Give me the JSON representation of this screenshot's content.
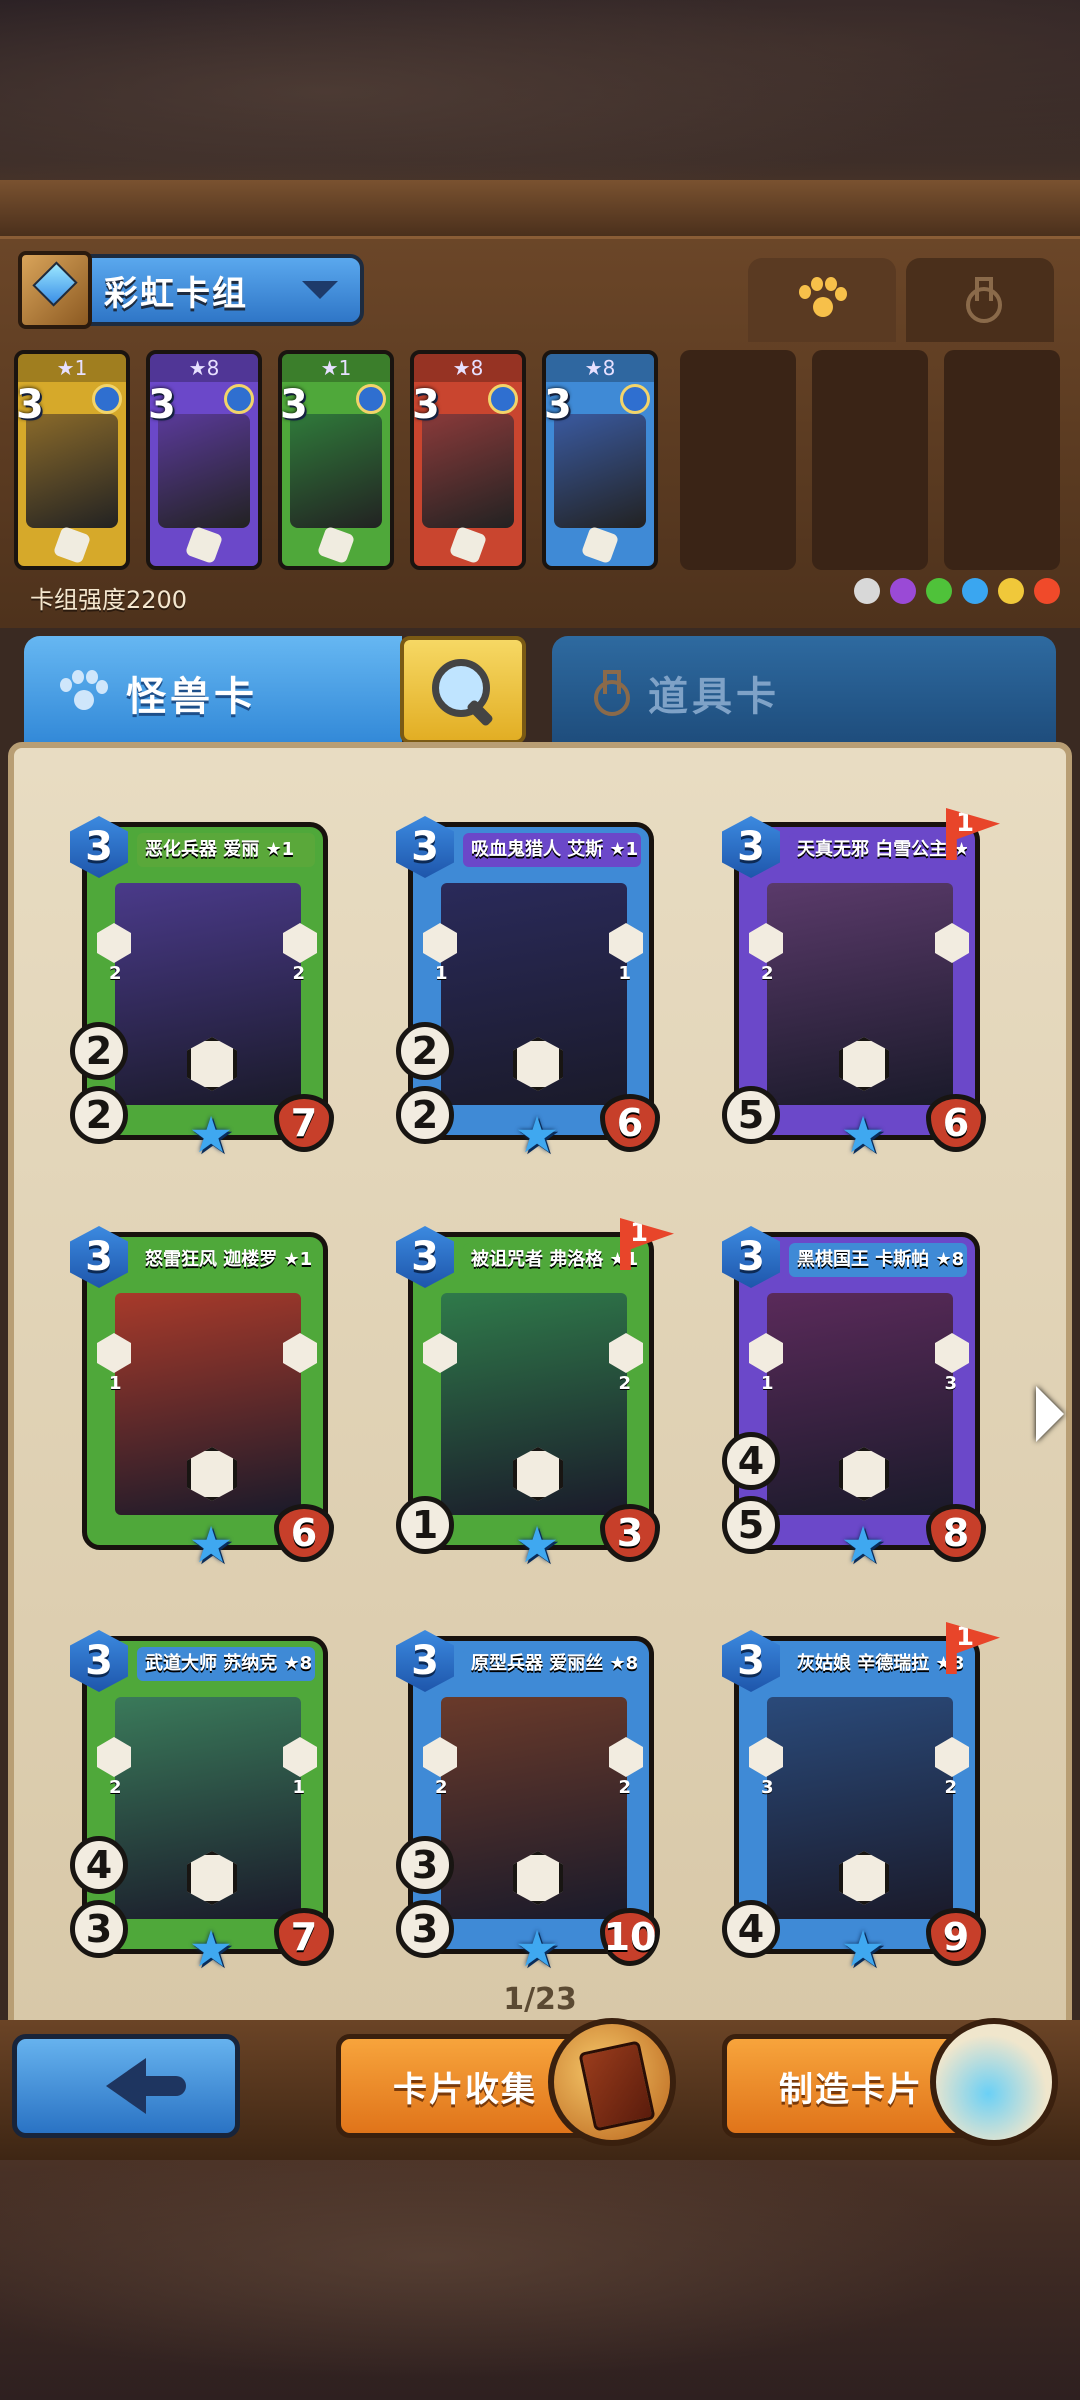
{
  "deck": {
    "name": "彩虹卡组",
    "strength_label": "卡组强度2200",
    "slots": [
      {
        "stars": "★1",
        "cost": "3",
        "color": "#d6a92a",
        "art": "#8a6a2a"
      },
      {
        "stars": "★8",
        "cost": "3",
        "color": "#6b48c9",
        "art": "#5a3a9a"
      },
      {
        "stars": "★1",
        "cost": "3",
        "color": "#4fa83a",
        "art": "#2f7a3a"
      },
      {
        "stars": "★8",
        "cost": "3",
        "color": "#c9452f",
        "art": "#8a3a3a"
      },
      {
        "stars": "★8",
        "cost": "3",
        "color": "#3f8ad6",
        "art": "#3a5aa0"
      }
    ],
    "element_colors": [
      "#d8d8d8",
      "#9a4ad6",
      "#4fc23a",
      "#3aa6f0",
      "#f0c83a",
      "#f04a2a"
    ]
  },
  "tabs": {
    "monster": "怪兽卡",
    "item": "道具卡"
  },
  "cards": [
    {
      "title": "恶化兵器 爱丽 ★1",
      "cost": "3",
      "atk": "2",
      "def": "2",
      "hp": "7",
      "frame": "#4fa83a",
      "banner": "#5aa83a",
      "art": "#4a3a8a",
      "left_side": "2",
      "right_side": "2",
      "flag": ""
    },
    {
      "title": "吸血鬼猎人 艾斯 ★1",
      "cost": "3",
      "atk": "2",
      "def": "2",
      "hp": "6",
      "frame": "#3f8ad6",
      "banner": "#6b48c9",
      "art": "#2a2a5a",
      "left_side": "1",
      "right_side": "1",
      "flag": ""
    },
    {
      "title": "天真无邪 白雪公主 ★8",
      "cost": "3",
      "atk": "5",
      "def": "",
      "hp": "6",
      "frame": "#6b48c9",
      "banner": "#6b48c9",
      "art": "#5a3a6a",
      "left_side": "2",
      "right_side": "",
      "flag": "1"
    },
    {
      "title": "怒雷狂风 迦楼罗 ★1",
      "cost": "3",
      "atk": "",
      "def": "",
      "hp": "6",
      "frame": "#4fa83a",
      "banner": "#4fa83a",
      "art": "#a83a2a",
      "left_side": "1",
      "right_side": "",
      "flag": ""
    },
    {
      "title": "被诅咒者 弗洛格 ★1",
      "cost": "3",
      "atk": "1",
      "def": "",
      "hp": "3",
      "frame": "#4fa83a",
      "banner": "#4fa83a",
      "art": "#2f7a4a",
      "left_side": "",
      "right_side": "2",
      "flag": "1"
    },
    {
      "title": "黑棋国王 卡斯帕 ★8",
      "cost": "3",
      "atk": "5",
      "def": "4",
      "hp": "8",
      "frame": "#6b48c9",
      "banner": "#3f8ad6",
      "art": "#5a2a5a",
      "left_side": "1",
      "right_side": "3",
      "flag": ""
    },
    {
      "title": "武道大师 苏纳克 ★8",
      "cost": "3",
      "atk": "3",
      "def": "4",
      "hp": "7",
      "frame": "#4fa83a",
      "banner": "#3f8ad6",
      "art": "#3a7a5a",
      "left_side": "2",
      "right_side": "1",
      "flag": ""
    },
    {
      "title": "原型兵器 爱丽丝 ★8",
      "cost": "3",
      "atk": "3",
      "def": "3",
      "hp": "10",
      "frame": "#3f8ad6",
      "banner": "#3f8ad6",
      "art": "#6a3a2a",
      "left_side": "2",
      "right_side": "2",
      "flag": ""
    },
    {
      "title": "灰姑娘 辛德瑞拉 ★8",
      "cost": "3",
      "atk": "4",
      "def": "",
      "hp": "9",
      "frame": "#3f8ad6",
      "banner": "#3f8ad6",
      "art": "#2a4a7a",
      "left_side": "3",
      "right_side": "2",
      "flag": "1"
    }
  ],
  "pagination": {
    "label": "1/23"
  },
  "buttons": {
    "collect": "卡片收集",
    "craft": "制造卡片"
  },
  "icons": {
    "monster_tab": "paw-icon",
    "item_tab": "flask-icon",
    "search": "magnifier-icon",
    "back": "back-arrow-icon",
    "next": "next-arrow-icon"
  }
}
